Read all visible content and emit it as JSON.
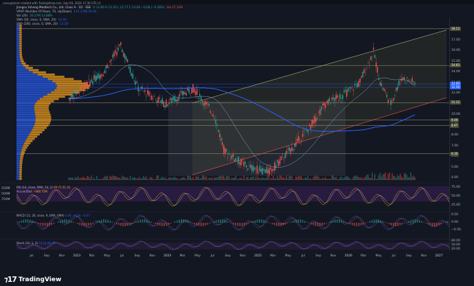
{
  "attribution": "caveyplanet created with TradingView.com, Sep 04, 2024 17:36 UTC+2",
  "legend": {
    "symbol": "Jiangsu Yuheng Medtech Co., Ltd. Class A · 1D · SSE",
    "ohlc": "O 12.80 H 13.33 L 12.77 C 13.00 −0.08 (−0.58%)",
    "vol": "Vol 27.31M",
    "vrvp": "VRVP (Number Of Rows, 70, Up/Down)",
    "vrvp_values": "133.178K 94.94",
    "vol20": "Vol (20)",
    "vol20_values": "20.27M 13.88M",
    "sma50": "SMA (50, close, 0, SMA, 20)",
    "sma50_value": "12.49",
    "sma200": "SMA (200, close, 0, SMA, 20)",
    "sma200_value": "12.50"
  },
  "currency": "CNY",
  "price_axis": {
    "ticks": [
      "17.00",
      "16.00",
      "15.00",
      "14.00",
      "13.00",
      "12.00",
      "11.00",
      "10.00",
      "9.00",
      "8.00",
      "7.00",
      "6.00",
      "5.00",
      "4.00"
    ],
    "tags": [
      {
        "label": "18.12",
        "color": "#3a3e28"
      },
      {
        "label": "14.65",
        "color": "#3a3e28"
      },
      {
        "label": "12.90",
        "color": "#2962ff"
      },
      {
        "label": "12.58",
        "color": "#2962ff"
      },
      {
        "label": "11.12",
        "color": "#3a3e28"
      },
      {
        "label": "9.49",
        "color": "#3a3e28"
      },
      {
        "label": "8.97",
        "color": "#3a3e28"
      },
      {
        "label": "6.30",
        "color": "#3a3e28"
      }
    ]
  },
  "tooltip_label": "00:00:00",
  "panels": {
    "rsi": {
      "label": "RSI (14, close, SMA, 14, 2)",
      "values": "50.71 51.31",
      "axis": [
        "75.00",
        "50.00",
        "25.00"
      ],
      "vol_axis": [
        "250M",
        "500M",
        "750M"
      ]
    },
    "accdist": {
      "label": "Accum/Dist",
      "value": "−908.75M"
    },
    "macd": {
      "label": "MACD (12, 26, close, 9, EMA, EMA)",
      "values": "0.06 −0.00 −0.07",
      "axis": [
        "0.50",
        "0.00",
        "−0.50"
      ]
    },
    "stoch": {
      "label": "Stoch (14, 1, 3)",
      "values": "73.51 60.79",
      "axis": [
        "80.00",
        "50.00",
        "20.00"
      ]
    }
  },
  "time_axis": [
    "Jul",
    "Sep",
    "Nov",
    "2023",
    "Mar",
    "May",
    "Jul",
    "Sep",
    "Nov",
    "2024",
    "Mar",
    "May",
    "Jul",
    "Sep",
    "Nov",
    "2025",
    "Mar",
    "May",
    "Jul",
    "Sep",
    "Nov",
    "2026",
    "Mar",
    "May",
    "Jul",
    "Sep",
    "Nov",
    "2027"
  ],
  "brand": "TradingView",
  "colors": {
    "background": "#131722",
    "up": "#26a69a",
    "down": "#ef5350",
    "sma": "#2962ff",
    "rsi": "#f7a21b",
    "channel": "#8c8f4a",
    "profile_up": "#2962ff",
    "profile_down": "#f7a21b"
  }
}
